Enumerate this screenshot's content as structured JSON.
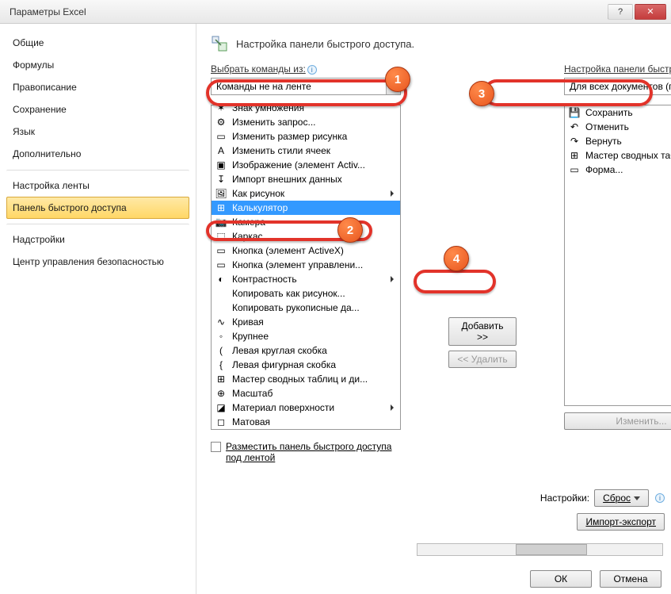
{
  "window": {
    "title": "Параметры Excel"
  },
  "sidebar": {
    "items": [
      {
        "label": "Общие"
      },
      {
        "label": "Формулы"
      },
      {
        "label": "Правописание"
      },
      {
        "label": "Сохранение"
      },
      {
        "label": "Язык"
      },
      {
        "label": "Дополнительно"
      },
      {
        "label": "Настройка ленты"
      },
      {
        "label": "Панель быстрого доступа"
      },
      {
        "label": "Надстройки"
      },
      {
        "label": "Центр управления безопасностью"
      }
    ],
    "selected_index": 7
  },
  "main": {
    "heading": "Настройка панели быстрого доступа.",
    "choose_label": "Выбрать команды из:",
    "choose_value": "Команды не на ленте",
    "customize_label": "Настройка панели быстрого д",
    "customize_value": "Для всех документов (по умол",
    "left_list": {
      "selected_index": 7,
      "items": [
        {
          "icon": "✶",
          "label": "Знак умножения"
        },
        {
          "icon": "⚙",
          "label": "Изменить запрос..."
        },
        {
          "icon": "▭",
          "label": "Изменить размер рисунка"
        },
        {
          "icon": "A",
          "label": "Изменить стили ячеек"
        },
        {
          "icon": "▣",
          "label": "Изображение (элемент Activ..."
        },
        {
          "icon": "↧",
          "label": "Импорт внешних данных"
        },
        {
          "icon": "🖼",
          "label": "Как рисунок",
          "submenu": true
        },
        {
          "icon": "⊞",
          "label": "Калькулятор"
        },
        {
          "icon": "📷",
          "label": "Камера"
        },
        {
          "icon": "⬚",
          "label": "Каркас"
        },
        {
          "icon": "▭",
          "label": "Кнопка (элемент ActiveX)"
        },
        {
          "icon": "▭",
          "label": "Кнопка (элемент управлени..."
        },
        {
          "icon": "◐",
          "label": "Контрастность",
          "submenu": true
        },
        {
          "icon": "",
          "label": "Копировать как рисунок..."
        },
        {
          "icon": "",
          "label": "Копировать рукописные да..."
        },
        {
          "icon": "∿",
          "label": "Кривая"
        },
        {
          "icon": "◦",
          "label": "Крупнее"
        },
        {
          "icon": "(",
          "label": "Левая круглая скобка"
        },
        {
          "icon": "{",
          "label": "Левая фигурная скобка"
        },
        {
          "icon": "⊞",
          "label": "Мастер сводных таблиц и ди..."
        },
        {
          "icon": "⊕",
          "label": "Масштаб"
        },
        {
          "icon": "◪",
          "label": "Материал поверхности",
          "submenu": true
        },
        {
          "icon": "◻",
          "label": "Матовая"
        }
      ]
    },
    "right_list": {
      "items": [
        {
          "icon": "💾",
          "label": "Сохранить"
        },
        {
          "icon": "↶",
          "label": "Отменить"
        },
        {
          "icon": "↷",
          "label": "Вернуть"
        },
        {
          "icon": "⊞",
          "label": "Мастер сводных таблиц и"
        },
        {
          "icon": "▭",
          "label": "Форма..."
        }
      ]
    },
    "add_label": "Добавить >>",
    "remove_label": "<< Удалить",
    "show_below_label": "Разместить панель быстрого доступа под лентой",
    "modify_label": "Изменить...",
    "settings_label": "Настройки:",
    "reset_label": "Сброс",
    "import_export_label": "Импорт-экспорт"
  },
  "buttons": {
    "ok": "ОК",
    "cancel": "Отмена"
  },
  "annotations": {
    "b1": "1",
    "b2": "2",
    "b3": "3",
    "b4": "4"
  }
}
